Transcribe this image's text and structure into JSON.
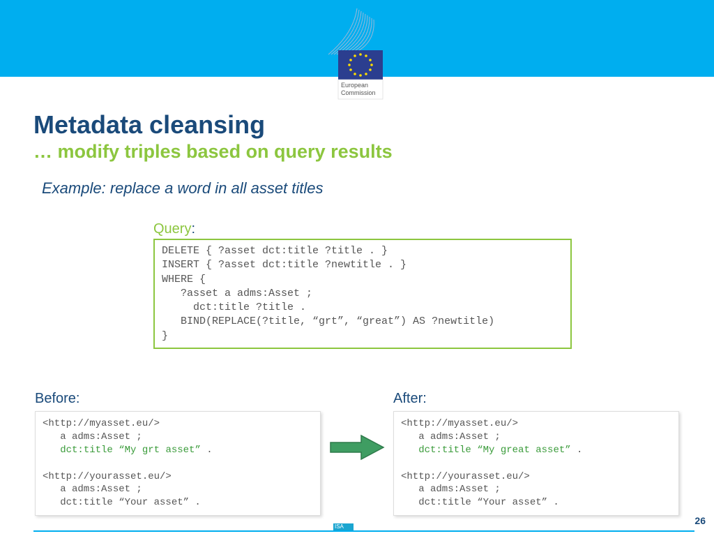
{
  "header": {
    "logo_label_top": "European",
    "logo_label_bottom": "Commission"
  },
  "title": "Metadata cleansing",
  "subtitle": "… modify triples based on query results",
  "example": "Example: replace a word in all asset titles",
  "query": {
    "label": "Query",
    "code": "DELETE { ?asset dct:title ?title . }\nINSERT { ?asset dct:title ?newtitle . }\nWHERE {\n   ?asset a adms:Asset ;\n     dct:title ?title .\n   BIND(REPLACE(?title, “grt”, “great”) AS ?newtitle)\n}"
  },
  "before": {
    "label": "Before:",
    "l1": "<http://myasset.eu/>",
    "l2": "   a adms:Asset ;",
    "l3_pre": "   ",
    "l3_hl": "dct:title “My grt asset”",
    "l3_post": " .",
    "l5": "<http://yourasset.eu/>",
    "l6": "   a adms:Asset ;",
    "l7": "   dct:title “Your asset” ."
  },
  "after": {
    "label": "After:",
    "l1": "<http://myasset.eu/>",
    "l2": "   a adms:Asset ;",
    "l3_pre": "   ",
    "l3_hl": "dct:title “My great asset”",
    "l3_post": " .",
    "l5": "<http://yourasset.eu/>",
    "l6": "   a adms:Asset ;",
    "l7": "   dct:title “Your asset” ."
  },
  "page_number": "26",
  "isa": "ISA"
}
